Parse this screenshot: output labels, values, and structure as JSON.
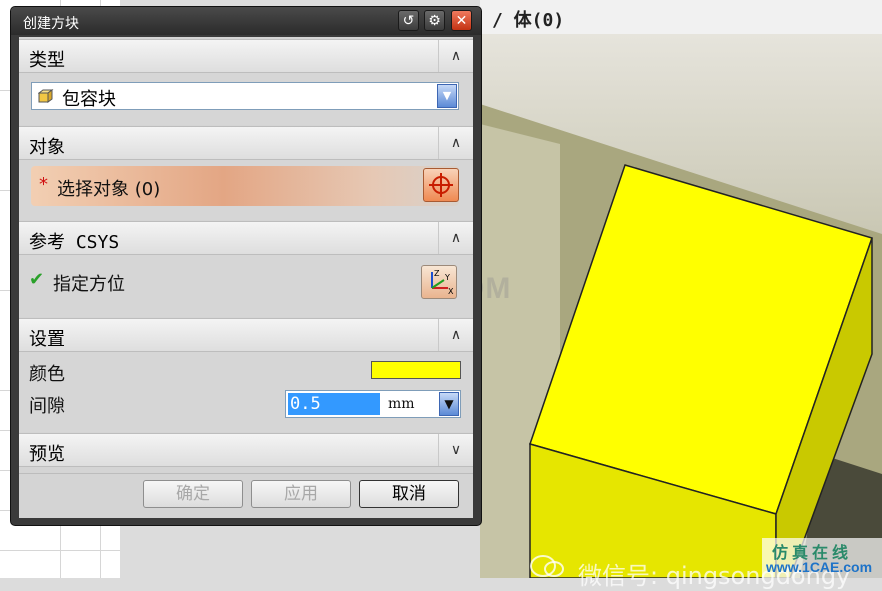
{
  "dialog": {
    "title": "创建方块",
    "buttons": {
      "reset": "↺",
      "settings": "⚙",
      "close": "✕"
    }
  },
  "sections": {
    "type": {
      "title": "类型",
      "toggle": "∧",
      "selected": "包容块",
      "dropdown_arrow": "▼"
    },
    "object": {
      "title": "对象",
      "toggle": "∧",
      "required_marker": "*",
      "select_label": "选择对象 (0)"
    },
    "csys": {
      "title": "参考 CSYS",
      "toggle": "∧",
      "check": "✔",
      "orient_label": "指定方位"
    },
    "settings": {
      "title": "设置",
      "toggle": "∧",
      "color_label": "颜色",
      "color_value": "#ffff00",
      "gap_label": "间隙",
      "gap_value": "0.5",
      "gap_unit": "mm",
      "unit_arrow": "▼"
    },
    "preview": {
      "title": "预览",
      "toggle": "∨"
    }
  },
  "footer": {
    "ok": "确定",
    "apply": "应用",
    "cancel": "取消"
  },
  "viewport": {
    "title": "/ 体(0)"
  },
  "overlays": {
    "watermark": "1CAE.COM",
    "wechat": "微信号: qingsongdongy",
    "site_name": "仿真在线",
    "site_url": "www.1CAE.com"
  },
  "colors": {
    "accent_orange": "#ef8a52",
    "block_yellow": "#ffff00",
    "dialog_frame": "#3a3a3a"
  }
}
